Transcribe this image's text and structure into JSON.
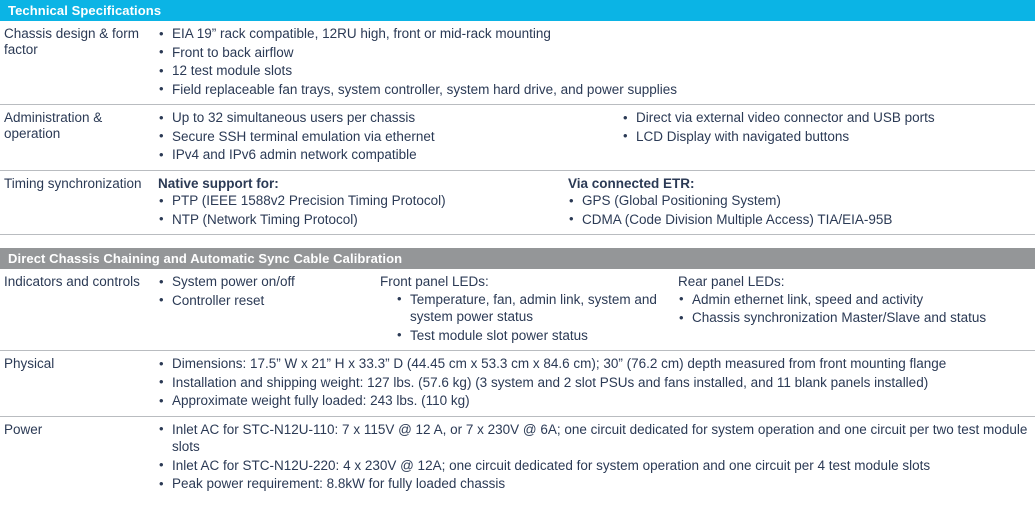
{
  "sections": [
    {
      "bar": {
        "title": "Technical Specifications",
        "style": "cyan"
      },
      "rows": [
        {
          "label": "Chassis design & form factor",
          "columns": [
            {
              "items": [
                "EIA 19” rack compatible, 12RU high, front or mid-rack mounting",
                "Front to back airflow",
                "12 test module slots",
                "Field replaceable fan trays, system controller, system hard drive, and power supplies"
              ]
            }
          ]
        },
        {
          "label": "Administration & operation",
          "columns": [
            {
              "items": [
                "Up to 32 simultaneous users per chassis",
                "Secure SSH terminal emulation via ethernet",
                "IPv4 and IPv6 admin network compatible"
              ]
            },
            {
              "items": [
                "Direct via external video connector and USB ports",
                "LCD Display with navigated buttons"
              ]
            }
          ]
        },
        {
          "label": "Timing synchronization",
          "columns": [
            {
              "subhead": "Native support for:",
              "items": [
                "PTP (IEEE 1588v2 Precision Timing Protocol)",
                "NTP (Network Timing Protocol)"
              ]
            },
            {
              "subhead": "Via connected ETR:",
              "items": [
                "GPS (Global Positioning System)",
                "CDMA (Code Division Multiple Access) TIA/EIA-95B"
              ]
            }
          ]
        }
      ]
    },
    {
      "bar": {
        "title": "Direct Chassis Chaining and Automatic Sync Cable Calibration",
        "style": "gray"
      },
      "rows": [
        {
          "label": "Indicators and controls",
          "columns": [
            {
              "items": [
                "System power on/off",
                "Controller reset"
              ]
            },
            {
              "subhead": "Front panel LEDs:",
              "items": [
                "Temperature, fan, admin link, system and system power status",
                "Test module slot power status"
              ]
            },
            {
              "subhead": "Rear panel LEDs:",
              "items": [
                "Admin ethernet link, speed and activity",
                "Chassis synchronization Master/Slave and status"
              ]
            }
          ]
        },
        {
          "label": "Physical",
          "columns": [
            {
              "items": [
                "Dimensions: 17.5” W x 21” H x 33.3” D (44.45 cm x 53.3 cm x 84.6 cm); 30” (76.2 cm) depth measured from front mounting flange",
                "Installation and shipping weight: 127 lbs. (57.6 kg) (3 system and 2 slot PSUs and fans installed, and 11 blank panels installed)",
                "Approximate weight fully loaded: 243 lbs. (110 kg)"
              ]
            }
          ]
        },
        {
          "label": "Power",
          "columns": [
            {
              "items": [
                "Inlet AC for STC-N12U-110: 7 x 115V @ 12 A, or 7 x 230V @ 6A; one circuit dedicated for system operation and one circuit per two test module slots",
                "Inlet AC for STC-N12U-220: 4 x 230V @ 12A; one circuit dedicated for system operation and one circuit per 4 test module slots",
                "Peak power requirement: 8.8kW for fully loaded chassis"
              ]
            }
          ]
        }
      ]
    }
  ],
  "colors": {
    "cyan_bar": "#0bb4e5",
    "gray_bar": "#949698",
    "text": "#2b3a55",
    "rule": "#b9bcc0"
  }
}
